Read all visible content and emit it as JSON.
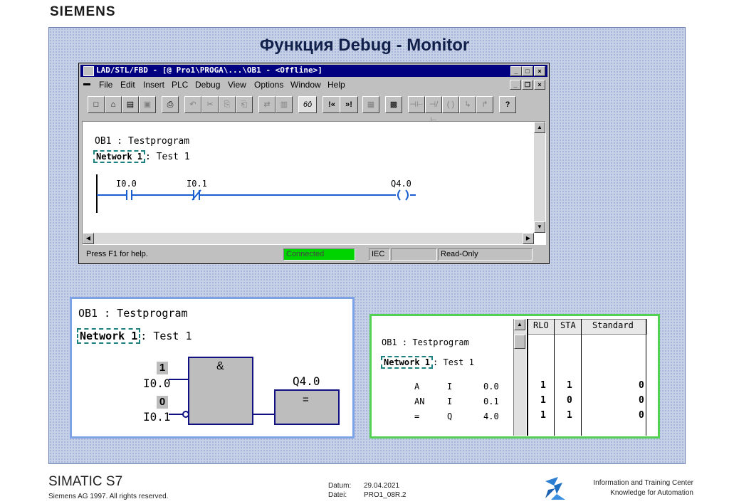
{
  "brand": "SIEMENS",
  "slide_title": "Функция Debug - Monitor",
  "window": {
    "title": "LAD/STL/FBD - [@ Pro1\\PROGA\\...\\OB1 - <Offline>]",
    "menu": [
      "File",
      "Edit",
      "Insert",
      "PLC",
      "Debug",
      "View",
      "Options",
      "Window",
      "Help"
    ],
    "toolbar_glyphs": [
      "□",
      "⌂",
      "▤",
      "▣",
      "⎙",
      "↶",
      "✂",
      "⎘",
      "⎗",
      "⇄",
      "▥",
      "6ô",
      "!«",
      "»!",
      "▦",
      "▩",
      "⊣⊢",
      "⊣/⊢",
      "( )",
      "↳",
      "↱",
      "?"
    ],
    "editor": {
      "block": "OB1 : Testprogram",
      "network": "Network 1",
      "network_title": ": Test 1",
      "contact1": "I0.0",
      "contact2": "I0.1",
      "coil": "Q4.0"
    },
    "status": {
      "help": "Press F1 for help.",
      "connection": "Connected",
      "mode": "IEC",
      "access": "Read-Only"
    }
  },
  "fbd_panel": {
    "block": "OB1 : Testprogram",
    "network": "Network 1",
    "network_title": ": Test 1",
    "and_label": "&",
    "input1": "I0.0",
    "input1_state": "1",
    "input2": "I0.1",
    "input2_state": "0",
    "output": "Q4.0",
    "assign_label": "="
  },
  "stl_panel": {
    "block": "OB1 : Testprogram",
    "network": "Network 1",
    "network_title": ": Test 1",
    "headers": [
      "RLO",
      "STA",
      "Standard"
    ],
    "rows": [
      {
        "op": "A",
        "area": "I",
        "addr": "0.0",
        "rlo": "1",
        "sta": "1",
        "std": "0"
      },
      {
        "op": "AN",
        "area": "I",
        "addr": "0.1",
        "rlo": "1",
        "sta": "0",
        "std": "0"
      },
      {
        "op": "=",
        "area": "Q",
        "addr": "4.0",
        "rlo": "1",
        "sta": "1",
        "std": "0"
      }
    ]
  },
  "footer": {
    "product": "SIMATIC S7",
    "copyright": "Siemens AG 1997. All rights reserved.",
    "date_label": "Datum:",
    "date": "29.04.2021",
    "file_label": "Datei:",
    "file": "PRO1_08R.2",
    "center_line1": "Information and Training Center",
    "center_line2": "Knowledge for Automation"
  }
}
